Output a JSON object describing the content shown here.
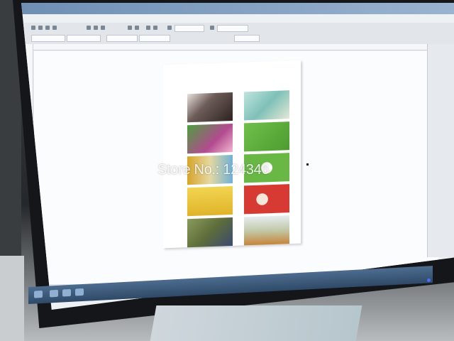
{
  "window": {
    "title": ""
  },
  "menu": {
    "items": [
      "",
      "",
      "",
      "",
      "",
      "",
      "",
      "",
      ""
    ]
  },
  "watermark": {
    "text": "Store No.: 124346"
  },
  "colors": {
    "screen_bg": "#eef1f4",
    "titlebar": "#7a97ba",
    "taskbar": "#3e5b7d",
    "led": "#4a6dff"
  },
  "layout_grid": {
    "tiles": [
      {
        "name": "portrait-photo",
        "color": "#5a4d4b"
      },
      {
        "name": "floral-photo",
        "color": "#7fc0b8"
      },
      {
        "name": "green-pink-card",
        "color": "#55a345"
      },
      {
        "name": "green-card",
        "color": "#5fb33f"
      },
      {
        "name": "fruit-blue-card",
        "color": "#d6a52a"
      },
      {
        "name": "green-white-card",
        "color": "#69b846"
      },
      {
        "name": "yellow-card",
        "color": "#e5c233"
      },
      {
        "name": "red-cartoon-card",
        "color": "#d63a32"
      },
      {
        "name": "garden-photo",
        "color": "#6a7a45"
      },
      {
        "name": "flower-field-card",
        "color": "#c2c9a9"
      }
    ]
  },
  "icons": {
    "power": "power-led-icon",
    "cursor": "cursor-icon"
  }
}
